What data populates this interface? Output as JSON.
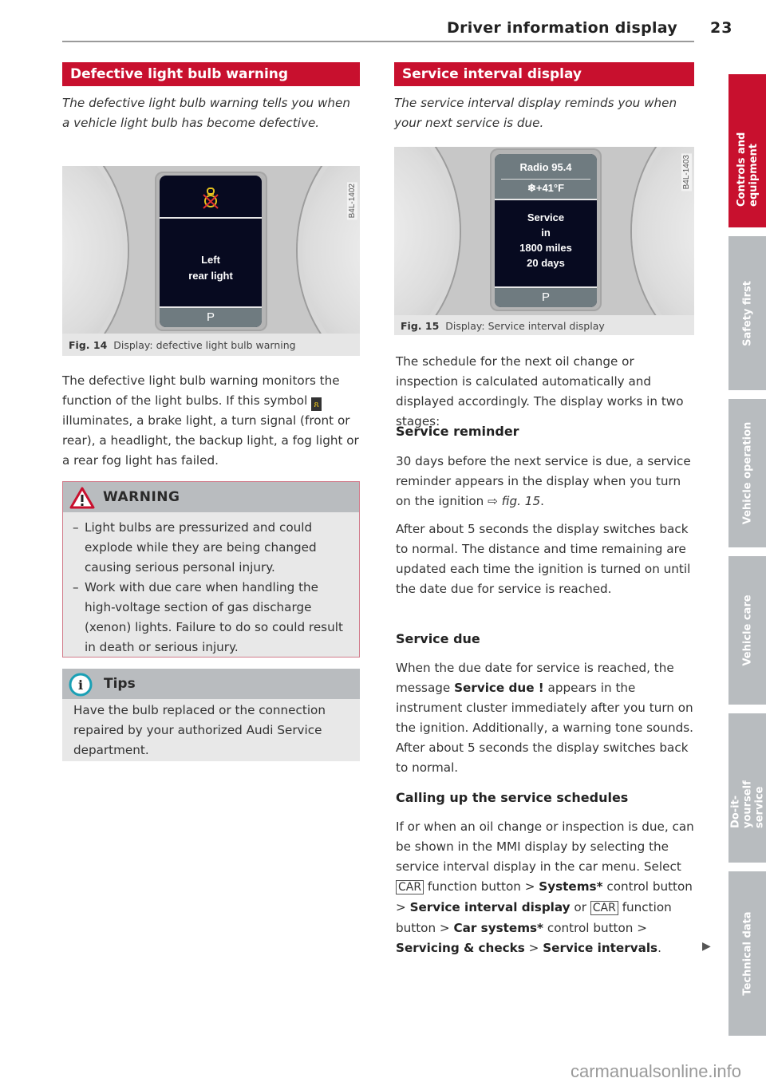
{
  "header": {
    "title": "Driver information display",
    "page_number": "23"
  },
  "left": {
    "section_title": "Defective light bulb warning",
    "intro": "The defective light bulb warning tells you when a vehicle light bulb has become defective.",
    "figure": {
      "code": "B4L-1402",
      "icon": "bulb-failure-icon",
      "screen_line1": "Left",
      "screen_line2": "rear light",
      "gear": "P",
      "caption_label": "Fig. 14",
      "caption_text": "Display: defective light bulb warning"
    },
    "body_before_icon": "The defective light bulb warning monitors the function of the light bulbs. If this symbol",
    "body_after_icon": "illuminates, a brake light, a turn signal (front or rear), a headlight, the backup light, a fog light or a rear fog light has failed.",
    "warning": {
      "title": "WARNING",
      "items": [
        "Light bulbs are pressurized and could explode while they are being changed causing serious personal injury.",
        "Work with due care when handling the high-voltage section of gas discharge (xenon) lights. Failure to do so could result in death or serious injury."
      ]
    },
    "tips": {
      "title": "Tips",
      "text": "Have the bulb replaced or the connection repaired by your authorized Audi Service department."
    }
  },
  "right": {
    "section_title": "Service interval display",
    "intro": "The service interval display reminds you when your next service is due.",
    "figure": {
      "code": "B4L-1403",
      "radio": "Radio 95.4",
      "temp": "❄+41°F",
      "screen_lines": [
        "Service",
        "in",
        "1800 miles",
        "20 days"
      ],
      "gear": "P",
      "caption_label": "Fig. 15",
      "caption_text": "Display: Service interval display"
    },
    "para1": "The schedule for the next oil change or inspection is calculated automatically and displayed accordingly. The display works in two stages:",
    "h_reminder": "Service reminder",
    "para2a": "30 days before the next service is due, a service reminder appears in the display when you turn on the ignition ",
    "para2_ref": "⇨ fig. 15",
    "para2b": ".",
    "para3": "After about 5 seconds the display switches back to normal. The distance and time remaining are updated each time the ignition is turned on until the date due for service is reached.",
    "h_due": "Service due",
    "para4a": "When the due date for service is reached, the message ",
    "para4_bold": "Service due !",
    "para4b": " appears in the instrument cluster immediately after you turn on the ignition. Additionally, a warning tone sounds. After about 5 seconds the display switches back to normal.",
    "h_calling": "Calling up the service schedules",
    "para5": "If or when an oil change or inspection is due, can be shown in the MMI display by selecting the service interval display in the car menu.",
    "select": "Select",
    "car_key": "CAR",
    "fb": "function button",
    "gt": ">",
    "systems": "Systems*",
    "control_button": "control button",
    "sid": "Service interval display",
    "or": "or",
    "car_systems": "Car systems*",
    "control_but": "control button",
    "servicing": "Servicing & checks",
    "service_intervals": "Service intervals",
    "continue_arrow": "▶"
  },
  "side_tabs": [
    {
      "label": "Controls and equipment",
      "active": true
    },
    {
      "label": "Safety first",
      "active": false
    },
    {
      "label": "Vehicle operation",
      "active": false
    },
    {
      "label": "Vehicle care",
      "active": false
    },
    {
      "label": "Do-it-yourself service",
      "active": false
    },
    {
      "label": "Technical data",
      "active": false
    }
  ],
  "watermark": "carmanualsonline.info",
  "colors": {
    "accent": "#c8102e",
    "tab_inactive": "#b8bcbf",
    "box_header": "#b9bcbf"
  }
}
